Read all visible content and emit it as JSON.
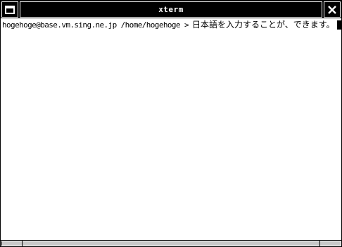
{
  "window": {
    "title": "xterm",
    "menu_icon": "window-menu-icon",
    "close_icon": "close-icon"
  },
  "terminal": {
    "prompt": "hogehoge@base.vm.sing.ne.jp /home/hogehoge >",
    "input": "日本語を入力することが、できます。"
  },
  "colors": {
    "titlebar": "#000000",
    "title_text": "#ffffff",
    "terminal_bg": "#ffffff",
    "terminal_fg": "#000000"
  }
}
